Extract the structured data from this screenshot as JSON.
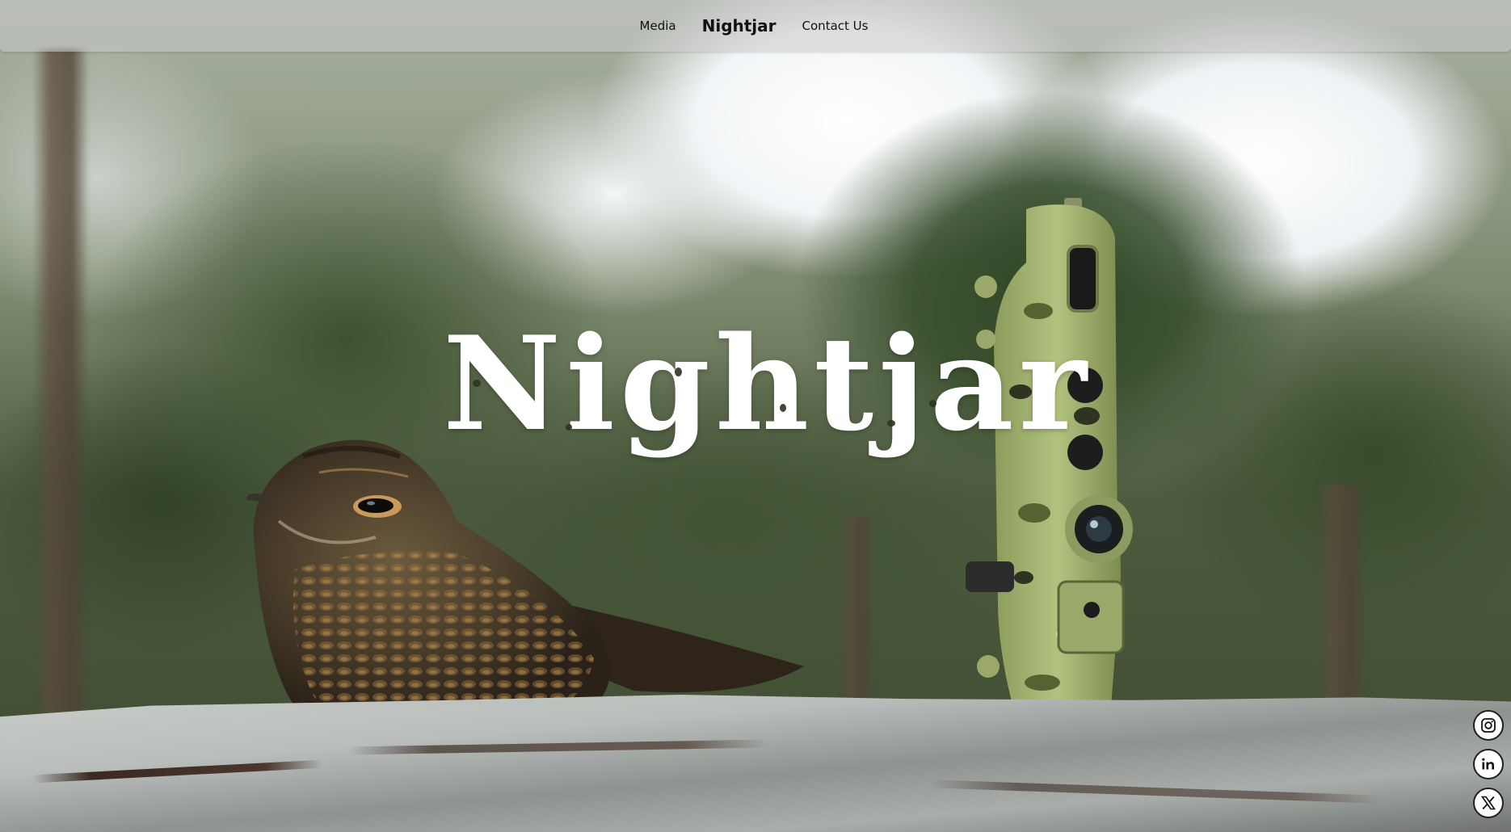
{
  "nav": {
    "left_link": "Media",
    "brand": "Nightjar",
    "right_link": "Contact Us"
  },
  "hero": {
    "title": "Nightjar"
  },
  "social": [
    {
      "icon": "instagram-icon"
    },
    {
      "icon": "linkedin-icon"
    },
    {
      "icon": "x-icon"
    }
  ],
  "colors": {
    "nav_background": "#c8c8c8",
    "hero_text": "#ffffff",
    "social_border": "#1f1f1f"
  }
}
